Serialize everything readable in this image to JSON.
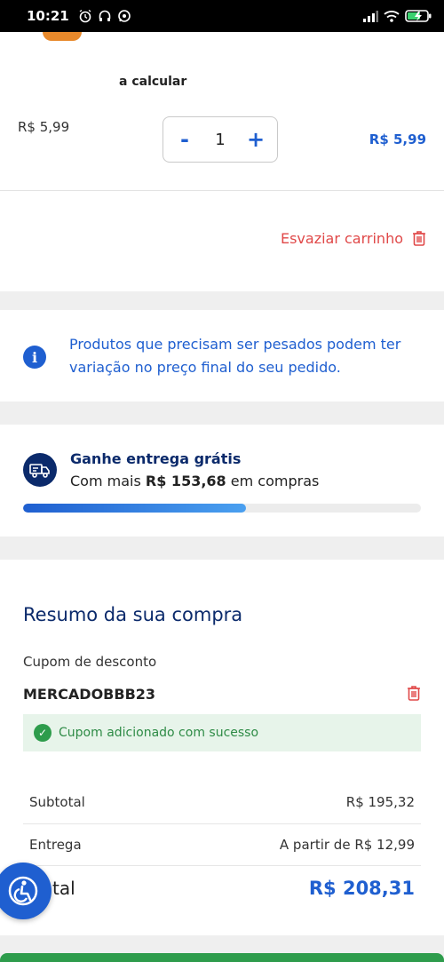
{
  "status_bar": {
    "time": "10:21"
  },
  "cart_item": {
    "shipping_note": "a calcular",
    "unit_price": "R$ 5,99",
    "quantity": "1",
    "decrement_label": "-",
    "increment_label": "+",
    "line_total": "R$ 5,99"
  },
  "cart_actions": {
    "empty_cart_label": "Esvaziar carrinho"
  },
  "weight_notice": {
    "text": "Produtos que precisam ser pesados podem ter variação no preço final do seu pedido."
  },
  "free_shipping": {
    "title": "Ganhe entrega grátis",
    "prefix": "Com mais",
    "amount": "R$ 153,68",
    "suffix": "em compras",
    "progress_fraction": 0.56
  },
  "summary": {
    "title": "Resumo da sua compra",
    "coupon_label": "Cupom de desconto",
    "coupon_code": "MERCADOBBB23",
    "coupon_success": "Cupom adicionado com sucesso",
    "rows": [
      {
        "label": "Subtotal",
        "value": "R$ 195,32"
      },
      {
        "label": "Entrega",
        "value": "A partir de R$ 12,99"
      },
      {
        "label": "tal",
        "value": "R$ 208,31"
      }
    ]
  },
  "colors": {
    "accent": "#1f5fd0",
    "danger": "#e04848",
    "navy": "#0b2a6b",
    "success": "#2e9c4c"
  }
}
